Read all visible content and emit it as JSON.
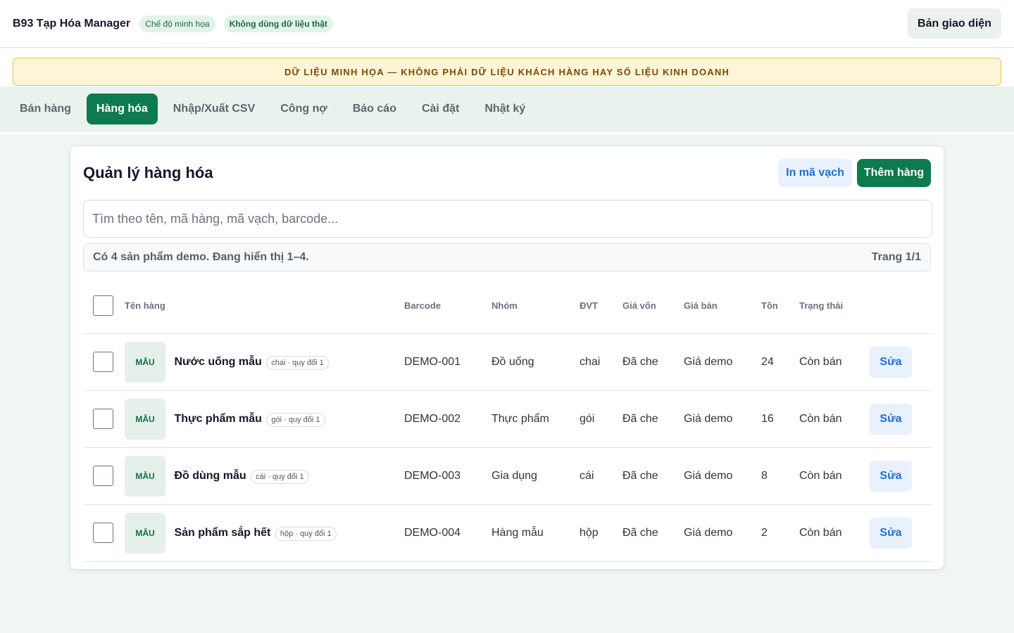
{
  "header": {
    "title": "B93 Tạp Hóa Manager",
    "chip_demo_mode": "Chế độ minh họa",
    "chip_no_real_data": "Không dùng dữ liệu thật",
    "theme_button": "Bản giao diện"
  },
  "banner": {
    "text": "DỮ LIỆU MINH HỌA — KHÔNG PHẢI DỮ LIỆU KHÁCH HÀNG HAY SỐ LIỆU KINH DOANH"
  },
  "nav": {
    "items": [
      {
        "label": "Bán hàng",
        "active": false
      },
      {
        "label": "Hàng hóa",
        "active": true
      },
      {
        "label": "Nhập/Xuất CSV",
        "active": false
      },
      {
        "label": "Công nợ",
        "active": false
      },
      {
        "label": "Báo cáo",
        "active": false
      },
      {
        "label": "Cài đặt",
        "active": false
      },
      {
        "label": "Nhật ký",
        "active": false
      }
    ]
  },
  "products": {
    "title": "Quản lý hàng hóa",
    "print_barcode_button": "In mã vạch",
    "add_button": "Thêm hàng",
    "search_placeholder": "Tìm theo tên, mã hàng, mã vạch, barcode...",
    "summary": "Có 4 sản phẩm demo. Đang hiển thị 1–4.",
    "page_info": "Trang 1/1",
    "columns": {
      "name": "Tên hàng",
      "barcode": "Barcode",
      "group": "Nhóm",
      "unit": "ĐVT",
      "cost": "Giá vốn",
      "price": "Giá bán",
      "stock": "Tồn",
      "status": "Trạng thái"
    },
    "rows": [
      {
        "thumb": "MẪU",
        "name": "Nước uống mẫu",
        "unit_chip": "chai · quy đổi 1",
        "barcode": "DEMO-001",
        "group": "Đồ uống",
        "unit": "chai",
        "cost": "Đã che",
        "price": "Giá demo",
        "stock": "24",
        "status": "Còn bán",
        "edit": "Sửa"
      },
      {
        "thumb": "MẪU",
        "name": "Thực phẩm mẫu",
        "unit_chip": "gói · quy đổi 1",
        "barcode": "DEMO-002",
        "group": "Thực phẩm",
        "unit": "gói",
        "cost": "Đã che",
        "price": "Giá demo",
        "stock": "16",
        "status": "Còn bán",
        "edit": "Sửa"
      },
      {
        "thumb": "MẪU",
        "name": "Đồ dùng mẫu",
        "unit_chip": "cái · quy đổi 1",
        "barcode": "DEMO-003",
        "group": "Gia dụng",
        "unit": "cái",
        "cost": "Đã che",
        "price": "Giá demo",
        "stock": "8",
        "status": "Còn bán",
        "edit": "Sửa"
      },
      {
        "thumb": "MẪU",
        "name": "Sản phẩm sắp hết",
        "unit_chip": "hộp · quy đổi 1",
        "barcode": "DEMO-004",
        "group": "Hàng mẫu",
        "unit": "hộp",
        "cost": "Đã che",
        "price": "Giá demo",
        "stock": "2",
        "status": "Còn bán",
        "edit": "Sửa"
      }
    ]
  }
}
